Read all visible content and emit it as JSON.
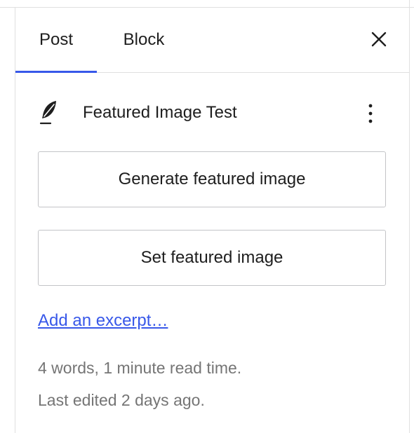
{
  "tabs": [
    {
      "label": "Post",
      "active": true
    },
    {
      "label": "Block",
      "active": false
    }
  ],
  "icons": {
    "close": "close-icon",
    "post_type": "feather-icon",
    "more": "more-vertical-icon"
  },
  "post": {
    "title": "Featured Image Test"
  },
  "buttons": {
    "generate_label": "Generate featured image",
    "set_label": "Set featured image"
  },
  "excerpt_link": "Add an excerpt…",
  "meta": {
    "words": "4 words, 1 minute read time.",
    "last_edited": "Last edited 2 days ago."
  },
  "colors": {
    "accent": "#3858e9",
    "text": "#1e1e1e",
    "muted": "#757575",
    "border": "#c3c4c7"
  }
}
